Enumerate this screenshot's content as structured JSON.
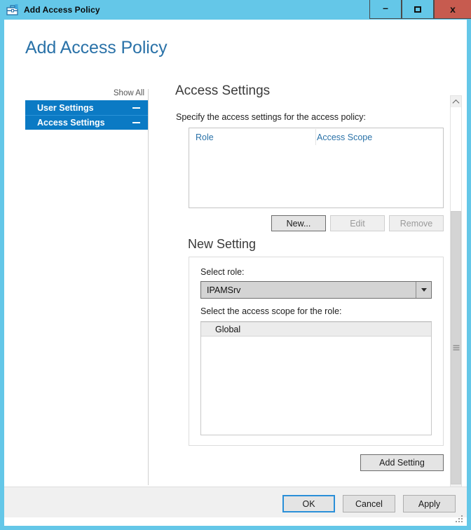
{
  "window": {
    "title": "Add Access Policy",
    "icon": "ipam-toolbox-icon",
    "controls": {
      "minimize": "–",
      "maximize": "□",
      "close": "x"
    },
    "titlebar_color": "#64c7e8",
    "close_color": "#c75b4f"
  },
  "page": {
    "heading": "Add Access Policy",
    "heading_color": "#2a72a8"
  },
  "sidebar": {
    "show_all": "Show All",
    "accent_color": "#0b7ac4",
    "items": [
      {
        "label": "User Settings",
        "collapse_glyph": "minus-icon"
      },
      {
        "label": "Access Settings",
        "collapse_glyph": "minus-icon"
      }
    ]
  },
  "main": {
    "section_title": "Access Settings",
    "instruction": "Specify the access settings for the access policy:",
    "policy_table": {
      "columns": [
        "Role",
        "Access Scope"
      ],
      "rows": []
    },
    "table_buttons": [
      {
        "label": "New...",
        "enabled": true
      },
      {
        "label": "Edit",
        "enabled": false
      },
      {
        "label": "Remove",
        "enabled": false
      }
    ],
    "new_setting": {
      "title": "New Setting",
      "role_label": "Select role:",
      "role_value": "IPAMSrv",
      "role_dropdown_icon": "chevron-down-icon",
      "scope_label": "Select the access scope for the role:",
      "scope_items": [
        {
          "label": "Global",
          "selected": true
        }
      ],
      "add_button": "Add Setting"
    }
  },
  "scrollbar": {
    "up_icon": "chevron-up-icon",
    "down_icon": "chevron-down-icon"
  },
  "footer": {
    "ok": "OK",
    "cancel": "Cancel",
    "apply": "Apply"
  }
}
